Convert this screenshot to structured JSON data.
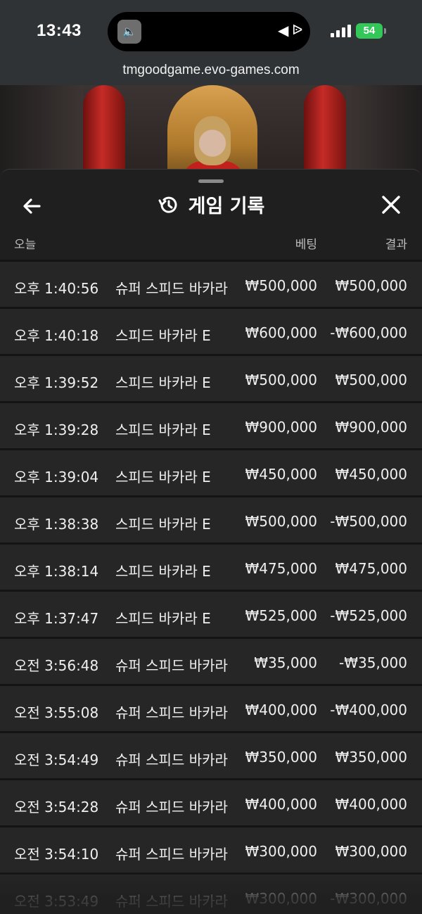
{
  "status_bar": {
    "time": "13:43",
    "battery": "54"
  },
  "browser": {
    "url": "tmgoodgame.evo-games.com"
  },
  "sheet": {
    "title": "게임 기록",
    "header": {
      "date": "오늘",
      "bet": "베팅",
      "result": "결과"
    },
    "rows": [
      {
        "time": "오후 1:40:56",
        "game": "슈퍼 스피드 바카라",
        "bet": "₩500,000",
        "result": "₩500,000"
      },
      {
        "time": "오후 1:40:18",
        "game": "스피드 바카라 E",
        "bet": "₩600,000",
        "result": "-₩600,000"
      },
      {
        "time": "오후 1:39:52",
        "game": "스피드 바카라 E",
        "bet": "₩500,000",
        "result": "₩500,000"
      },
      {
        "time": "오후 1:39:28",
        "game": "스피드 바카라 E",
        "bet": "₩900,000",
        "result": "₩900,000"
      },
      {
        "time": "오후 1:39:04",
        "game": "스피드 바카라 E",
        "bet": "₩450,000",
        "result": "₩450,000"
      },
      {
        "time": "오후 1:38:38",
        "game": "스피드 바카라 E",
        "bet": "₩500,000",
        "result": "-₩500,000"
      },
      {
        "time": "오후 1:38:14",
        "game": "스피드 바카라 E",
        "bet": "₩475,000",
        "result": "₩475,000"
      },
      {
        "time": "오후 1:37:47",
        "game": "스피드 바카라 E",
        "bet": "₩525,000",
        "result": "-₩525,000"
      },
      {
        "time": "오전 3:56:48",
        "game": "슈퍼 스피드 바카라",
        "bet": "₩35,000",
        "result": "-₩35,000"
      },
      {
        "time": "오전 3:55:08",
        "game": "슈퍼 스피드 바카라",
        "bet": "₩400,000",
        "result": "-₩400,000"
      },
      {
        "time": "오전 3:54:49",
        "game": "슈퍼 스피드 바카라",
        "bet": "₩350,000",
        "result": "₩350,000"
      },
      {
        "time": "오전 3:54:28",
        "game": "슈퍼 스피드 바카라",
        "bet": "₩400,000",
        "result": "₩400,000"
      },
      {
        "time": "오전 3:54:10",
        "game": "슈퍼 스피드 바카라",
        "bet": "₩300,000",
        "result": "₩300,000"
      },
      {
        "time": "오전 3:53:49",
        "game": "슈퍼 스피드 바카라",
        "bet": "₩300,000",
        "result": "-₩300,000"
      }
    ]
  }
}
